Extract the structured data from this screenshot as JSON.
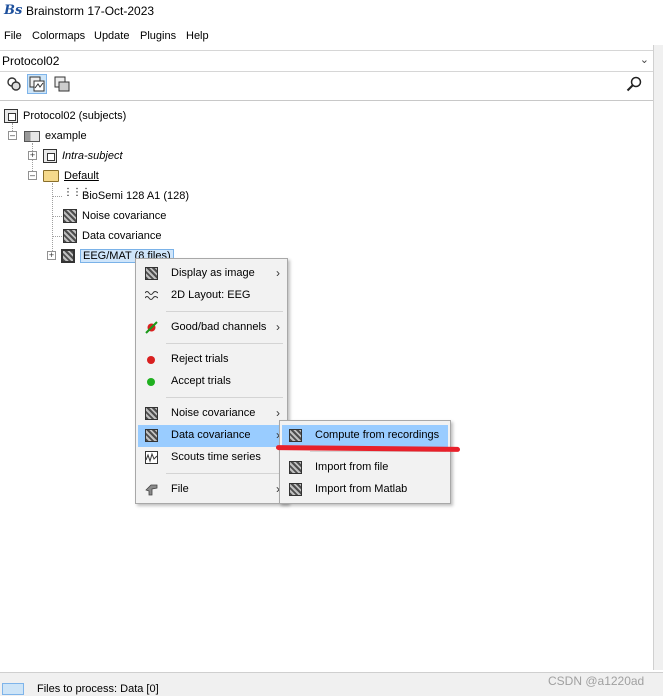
{
  "window": {
    "title": "Brainstorm 17-Oct-2023",
    "logo_text": "Bs"
  },
  "menubar": {
    "items": [
      "File",
      "Colormaps",
      "Update",
      "Plugins",
      "Help"
    ]
  },
  "protocol_selector": {
    "value": "Protocol02"
  },
  "toolbar": {
    "buttons": [
      "subjects-view-icon",
      "functional-view-icon",
      "studies-view-icon",
      "search-icon"
    ],
    "active_index": 1
  },
  "tree": {
    "root": "Protocol02 (subjects)",
    "subject": "example",
    "intra_subject": "Intra-subject",
    "default_folder": "Default",
    "channel_file": "BioSemi 128 A1 (128)",
    "noise_cov": "Noise covariance",
    "data_cov": "Data covariance",
    "data_node": "EEG/MAT (8 files)"
  },
  "context_menu": {
    "items": [
      {
        "label": "Display as image",
        "icon": "matrix-icon",
        "submenu": true
      },
      {
        "label": "2D Layout: EEG",
        "icon": "waves-icon",
        "submenu": false
      },
      {
        "label": "Good/bad channels",
        "icon": "good-bad-icon",
        "submenu": true
      },
      {
        "label": "Reject trials",
        "icon": "red-dot-icon",
        "submenu": false
      },
      {
        "label": "Accept trials",
        "icon": "green-dot-icon",
        "submenu": false
      },
      {
        "label": "Noise covariance",
        "icon": "matrix-icon",
        "submenu": true
      },
      {
        "label": "Data covariance",
        "icon": "matrix-icon",
        "submenu": true,
        "highlighted": true
      },
      {
        "label": "Scouts time series",
        "icon": "scout-icon",
        "submenu": false
      },
      {
        "label": "File",
        "icon": "tools-icon",
        "submenu": true
      }
    ]
  },
  "submenu": {
    "items": [
      {
        "label": "Compute from recordings",
        "highlighted": true
      },
      {
        "label": "Import from file"
      },
      {
        "label": "Import from Matlab"
      }
    ]
  },
  "status_bar": {
    "text": "Files to process: Data [0]"
  },
  "watermark": "CSDN @a1220ad",
  "colors": {
    "highlight": "#99ccff",
    "annotation": "#e8202a",
    "selection": "#cfe5fa"
  }
}
